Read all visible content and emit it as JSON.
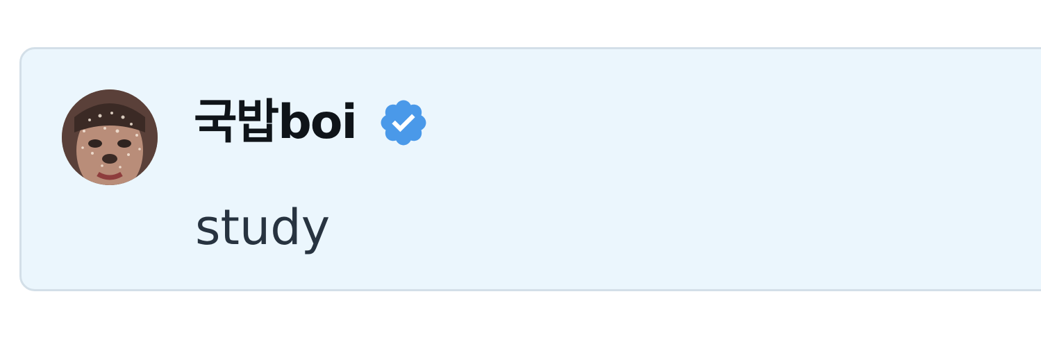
{
  "card": {
    "author": {
      "display_name": "국밥boi",
      "verified": true,
      "avatar_icon": "user-avatar"
    },
    "message": "study"
  },
  "colors": {
    "card_background": "#ebf6fd",
    "card_border": "#d3dfe8",
    "name_text": "#0f1419",
    "message_text": "#273340",
    "verified_badge": "#4a99e9"
  }
}
